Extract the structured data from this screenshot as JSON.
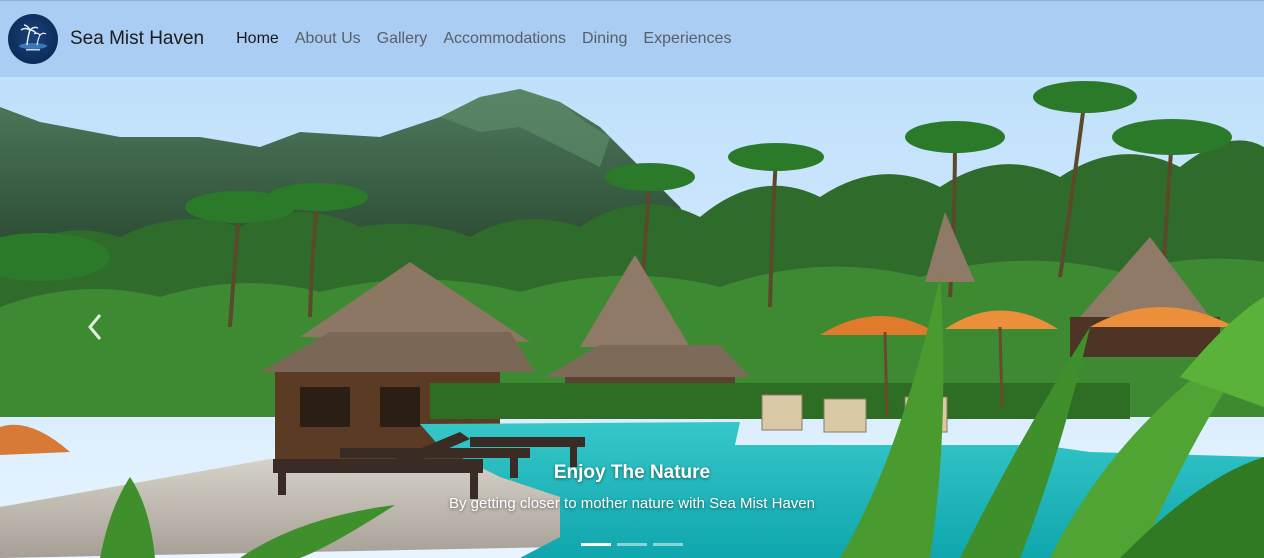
{
  "brand": {
    "name": "Sea Mist Haven",
    "logo_icon": "palm-island-logo-icon"
  },
  "nav": {
    "items": [
      {
        "label": "Home",
        "active": true
      },
      {
        "label": "About Us",
        "active": false
      },
      {
        "label": "Gallery",
        "active": false
      },
      {
        "label": "Accommodations",
        "active": false
      },
      {
        "label": "Dining",
        "active": false
      },
      {
        "label": "Experiences",
        "active": false
      }
    ]
  },
  "carousel": {
    "active_index": 1,
    "slide_count": 3,
    "caption": {
      "title": "Enjoy The Nature",
      "text": "By getting closer to mother nature with Sea Mist Haven"
    }
  },
  "colors": {
    "navbar_bg": "#a9cdf3",
    "brand_text": "#1d1d1d",
    "nav_link": "#5a5f66",
    "nav_link_active": "#1a1a1a",
    "logo_bg": "#0d2c5a"
  }
}
